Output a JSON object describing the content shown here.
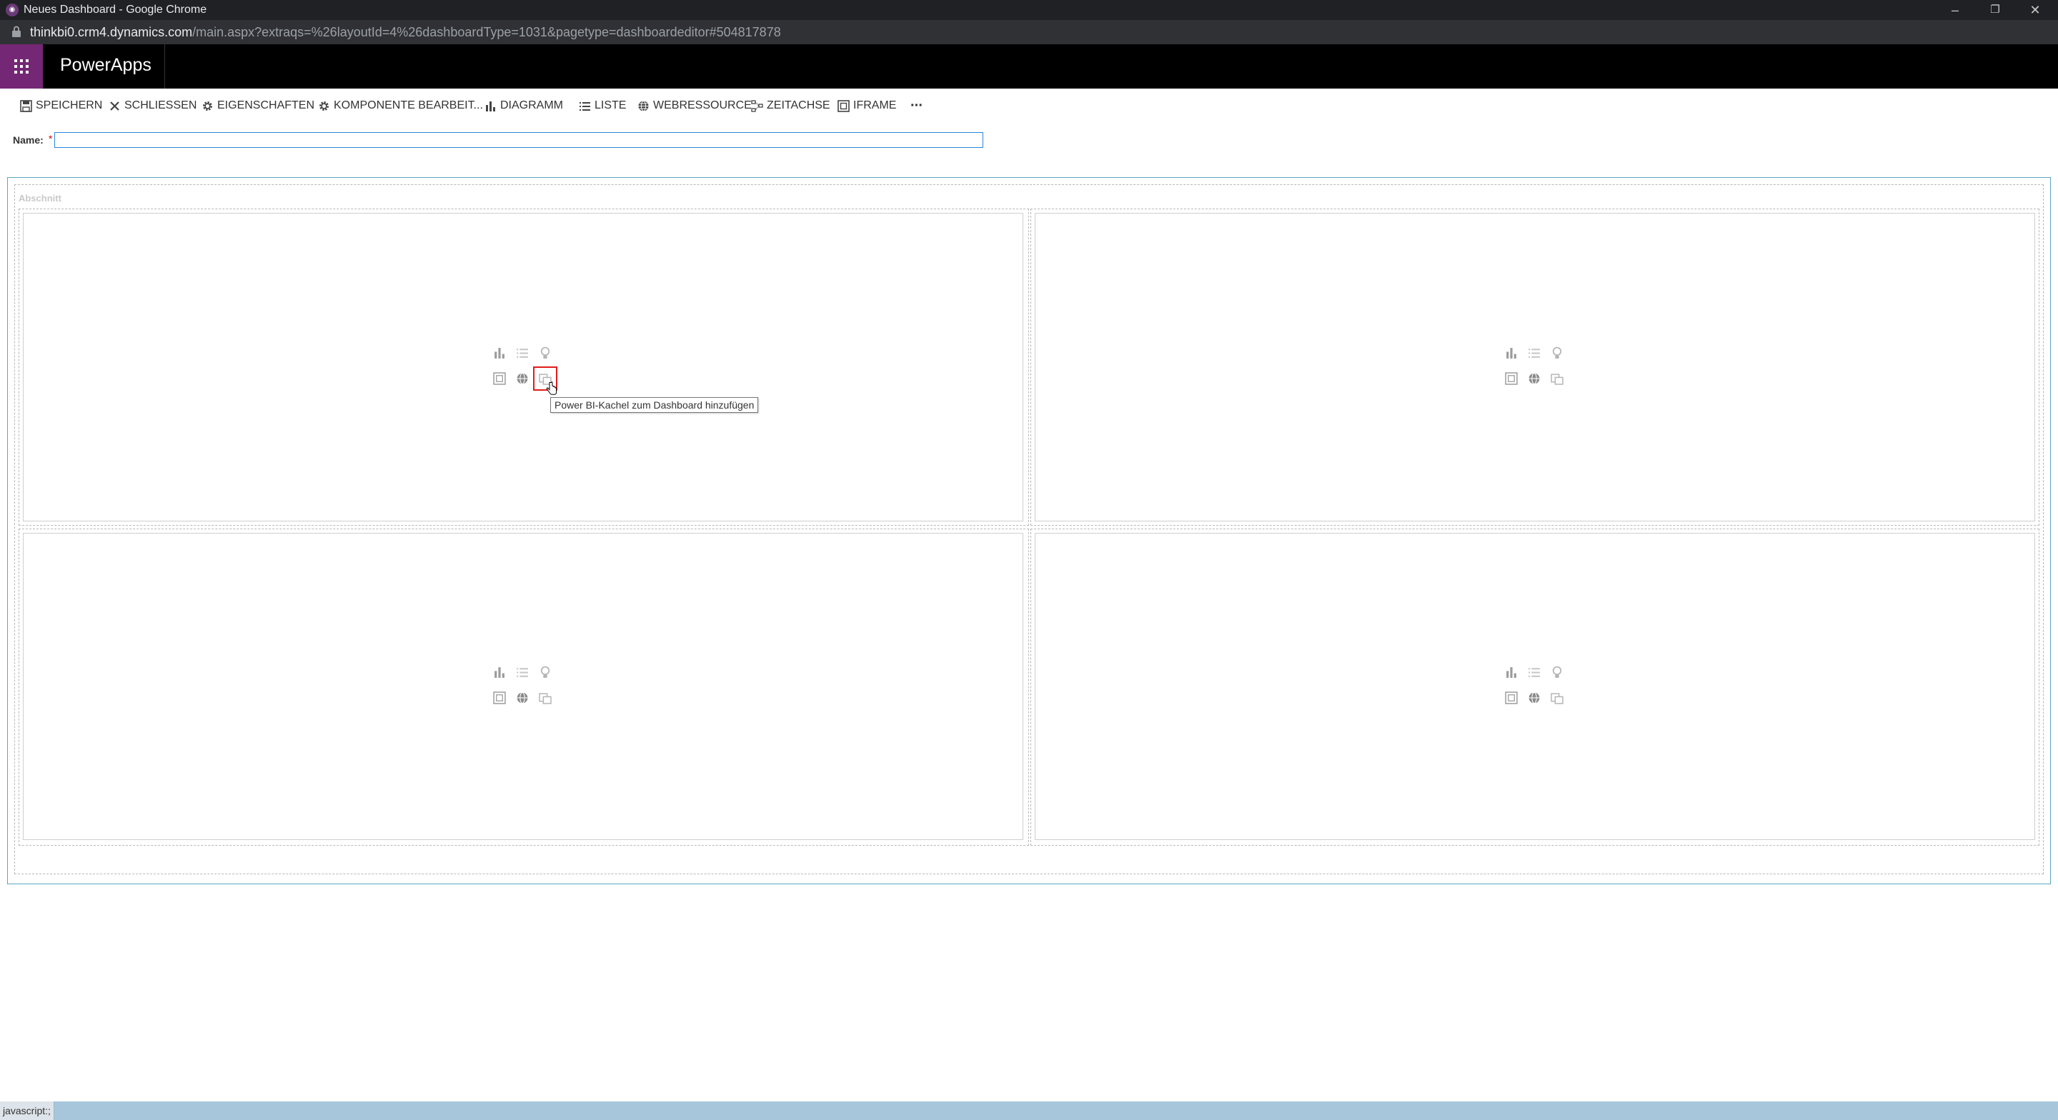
{
  "browser": {
    "window_title": "Neues Dashboard - Google Chrome",
    "url_host": "thinkbi0.crm4.dynamics.com",
    "url_path": "/main.aspx?extraqs=%26layoutId=4%26dashboardType=1031&pagetype=dashboardeditor#504817878",
    "controls": {
      "minimize": "–",
      "restore": "❐",
      "close": "✕"
    }
  },
  "app": {
    "name": "PowerApps",
    "brand_color": "#742774"
  },
  "toolbar": {
    "save": "SPEICHERN",
    "close": "SCHLIESSEN",
    "properties": "EIGENSCHAFTEN",
    "edit_component": "KOMPONENTE BEARBEIT...",
    "chart": "DIAGRAMM",
    "list": "LISTE",
    "web_resource": "WEBRESSOURCE",
    "timeline": "ZEITACHSE",
    "iframe": "IFRAME",
    "more": "···"
  },
  "form": {
    "name_label": "Name:",
    "required_marker": "*",
    "name_value": ""
  },
  "dashboard": {
    "section_label": "Abschnitt",
    "cells": [
      {
        "id": "top-left",
        "selected_tool": "powerbi"
      },
      {
        "id": "top-right",
        "selected_tool": ""
      },
      {
        "id": "bottom-left",
        "selected_tool": ""
      },
      {
        "id": "bottom-right",
        "selected_tool": ""
      }
    ],
    "tooltip": "Power BI-Kachel zum Dashboard hinzufügen",
    "icons": [
      "chart-icon",
      "list-icon",
      "lightbulb-icon",
      "iframe-icon",
      "globe-icon",
      "powerbi-icon"
    ]
  },
  "status": {
    "text": "javascript:;"
  }
}
